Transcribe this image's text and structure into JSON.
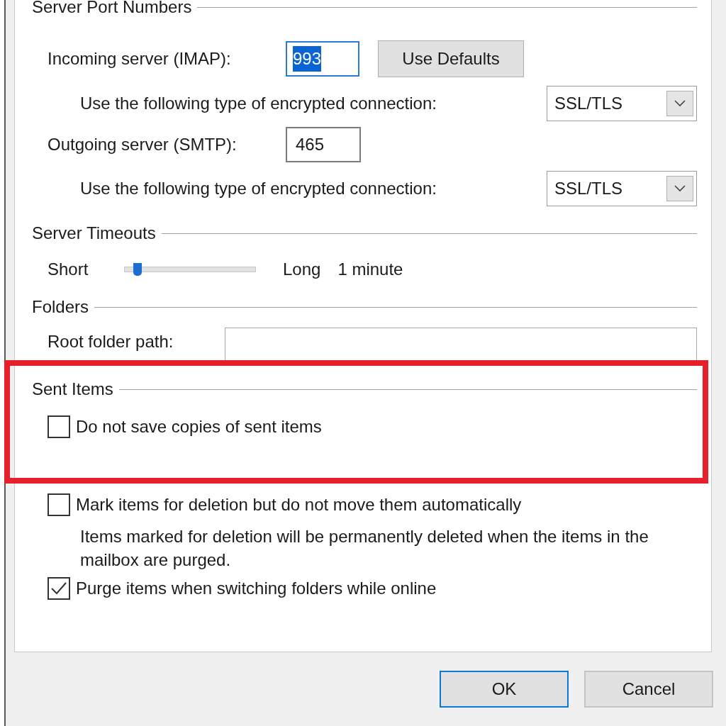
{
  "sections": [
    {
      "kind": "ports",
      "title": "Server Port Numbers",
      "incoming_label": "Incoming server (IMAP):",
      "incoming_value": "993",
      "incoming_selected": true,
      "defaults_button": "Use Defaults",
      "enc_label_1": "Use the following type of encrypted connection:",
      "enc_value_1": "SSL/TLS",
      "outgoing_label": "Outgoing server (SMTP):",
      "outgoing_value": "465",
      "enc_label_2": "Use the following type of encrypted connection:",
      "enc_value_2": "SSL/TLS"
    },
    {
      "kind": "timeout",
      "title": "Server Timeouts",
      "short_label": "Short",
      "long_label": "Long",
      "level": 0.1,
      "reading": "1 minute"
    },
    {
      "kind": "folders",
      "title": "Folders",
      "root_label": "Root folder path:"
    },
    {
      "kind": "sent",
      "title": "Sent Items",
      "highlighted": true,
      "options": [
        {
          "label": "Do not save copies of sent items",
          "checked": false
        }
      ]
    },
    {
      "kind": "deleted",
      "options": [
        {
          "label": "Mark items for deletion but do not move them automatically",
          "checked": false,
          "note": "Items marked for deletion will be permanently deleted when the items in the mailbox are purged."
        },
        {
          "label": "Purge items when switching folders while online",
          "checked": true
        }
      ]
    }
  ],
  "buttons": [
    {
      "label": "OK",
      "default": true
    },
    {
      "label": "Cancel",
      "default": false
    }
  ]
}
